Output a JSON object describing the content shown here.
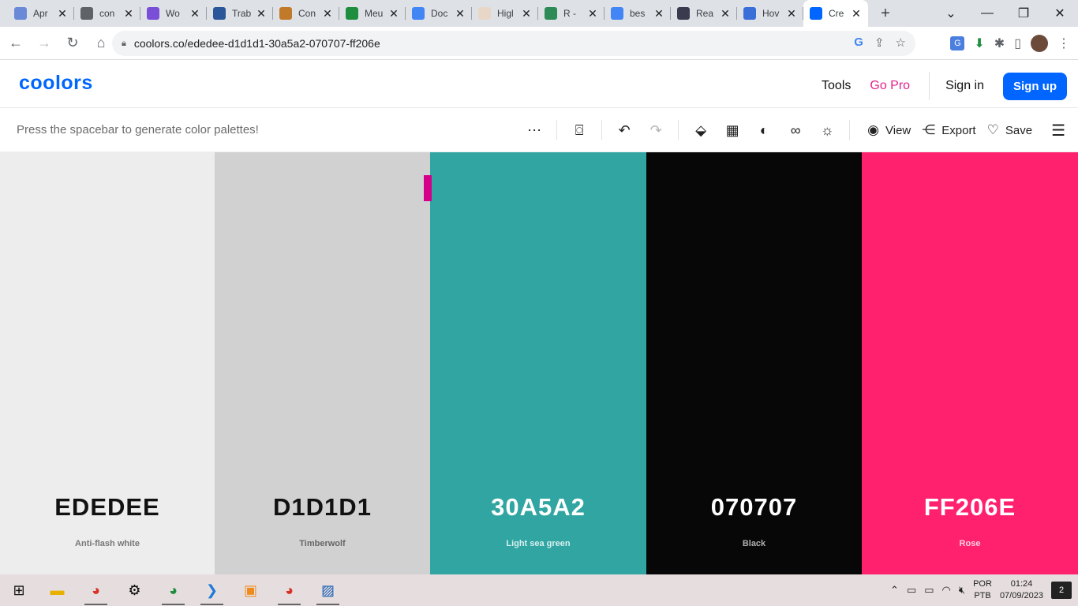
{
  "browser": {
    "tabs": [
      {
        "title": "Apr",
        "fav_color": "#6a8ad8"
      },
      {
        "title": "con",
        "fav_color": "#5f6368"
      },
      {
        "title": "Wo",
        "fav_color": "#7a4fd8"
      },
      {
        "title": "Trab",
        "fav_color": "#2b579a"
      },
      {
        "title": "Con",
        "fav_color": "#c17a2a"
      },
      {
        "title": "Meu",
        "fav_color": "#1e8e3e"
      },
      {
        "title": "Doc",
        "fav_color": "#4285f4"
      },
      {
        "title": "Higl",
        "fav_color": "#e8d7c7"
      },
      {
        "title": "R - ",
        "fav_color": "#2e8b57"
      },
      {
        "title": "bes",
        "fav_color": "#4285f4"
      },
      {
        "title": "Rea",
        "fav_color": "#3b3b4f"
      },
      {
        "title": "Hov",
        "fav_color": "#3b6fd8"
      },
      {
        "title": "Cre",
        "fav_color": "#0066ff"
      }
    ],
    "url": "coolors.co/ededee-d1d1d1-30a5a2-070707-ff206e"
  },
  "header": {
    "logo": "coolors",
    "tools": "Tools",
    "go_pro": "Go Pro",
    "sign_in": "Sign in",
    "sign_up": "Sign up"
  },
  "toolbar": {
    "hint": "Press the spacebar to generate color palettes!",
    "view": "View",
    "export": "Export",
    "save": "Save"
  },
  "palette": [
    {
      "hex": "EDEDEE",
      "name": "Anti-flash white",
      "bg": "#ededee",
      "fg": "#111111",
      "sub": "#777777"
    },
    {
      "hex": "D1D1D1",
      "name": "Timberwolf",
      "bg": "#d1d1d1",
      "fg": "#111111",
      "sub": "#666666"
    },
    {
      "hex": "30A5A2",
      "name": "Light sea green",
      "bg": "#30a5a2",
      "fg": "#ffffff",
      "sub": "#d8f0ef"
    },
    {
      "hex": "070707",
      "name": "Black",
      "bg": "#070707",
      "fg": "#ffffff",
      "sub": "#b0b0b0"
    },
    {
      "hex": "FF206E",
      "name": "Rose",
      "bg": "#ff206e",
      "fg": "#ffffff",
      "sub": "#ffd0e0"
    }
  ],
  "taskbar": {
    "lang1": "POR",
    "lang2": "PTB",
    "time": "01:24",
    "date": "07/09/2023",
    "notifications": "2"
  }
}
